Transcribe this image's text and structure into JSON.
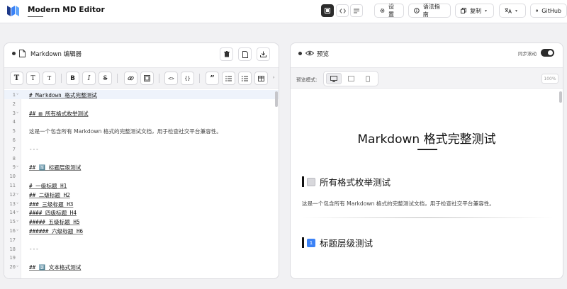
{
  "app": {
    "title": "Modern MD Editor",
    "brand_color": "#3b82f6"
  },
  "toolbar": {
    "view_modes": [
      {
        "name": "edit",
        "icon": "square-icon",
        "active": true
      },
      {
        "name": "split",
        "icon": "code-icon",
        "active": false
      },
      {
        "name": "preview",
        "icon": "lines-icon",
        "active": false
      }
    ],
    "settings_label": "设置",
    "syntax_label": "语法指南",
    "copy_label": "复制",
    "github_label": "GitHub"
  },
  "editor": {
    "title": "Markdown 编辑器",
    "formatting": [
      {
        "name": "heading-size",
        "label": "T"
      },
      {
        "name": "heading-medium",
        "label": "T"
      },
      {
        "name": "heading-small",
        "label": "T"
      },
      {
        "name": "bold",
        "label": "B"
      },
      {
        "name": "italic",
        "label": "I"
      },
      {
        "name": "strike",
        "label": "S"
      },
      {
        "name": "link",
        "label": ""
      },
      {
        "name": "image",
        "label": ""
      },
      {
        "name": "code",
        "label": "<>"
      },
      {
        "name": "code-block",
        "label": "{}"
      },
      {
        "name": "quote",
        "label": "”"
      },
      {
        "name": "bullet-list",
        "label": ""
      },
      {
        "name": "ordered-list",
        "label": ""
      },
      {
        "name": "table",
        "label": ""
      }
    ],
    "lines": [
      {
        "n": "1",
        "text": "# Markdown 格式完整测试",
        "fold": true,
        "kind": "heading",
        "active": true
      },
      {
        "n": "2",
        "text": "",
        "fold": false,
        "kind": "plain"
      },
      {
        "n": "3",
        "text": "## ▥ 所有格式枚举测试",
        "fold": true,
        "kind": "heading"
      },
      {
        "n": "4",
        "text": "",
        "fold": false,
        "kind": "plain"
      },
      {
        "n": "5",
        "text": "这是一个包含所有 Markdown 格式的完整测试文档，用于检查社交平台兼容性。",
        "fold": false,
        "kind": "plain"
      },
      {
        "n": "6",
        "text": "",
        "fold": false,
        "kind": "plain"
      },
      {
        "n": "7",
        "text": "---",
        "fold": false,
        "kind": "hr"
      },
      {
        "n": "8",
        "text": "",
        "fold": false,
        "kind": "plain"
      },
      {
        "n": "9",
        "text": "## 1️⃣ 标题层级测试",
        "fold": true,
        "kind": "heading"
      },
      {
        "n": "10",
        "text": "",
        "fold": false,
        "kind": "plain"
      },
      {
        "n": "11",
        "text": "# 一级标题 H1",
        "fold": false,
        "kind": "heading"
      },
      {
        "n": "12",
        "text": "## 二级标题 H2",
        "fold": true,
        "kind": "heading"
      },
      {
        "n": "13",
        "text": "### 三级标题 H3",
        "fold": true,
        "kind": "heading"
      },
      {
        "n": "14",
        "text": "#### 四级标题 H4",
        "fold": true,
        "kind": "heading"
      },
      {
        "n": "15",
        "text": "##### 五级标题 H5",
        "fold": true,
        "kind": "heading"
      },
      {
        "n": "16",
        "text": "###### 六级标题 H6",
        "fold": true,
        "kind": "heading"
      },
      {
        "n": "17",
        "text": "",
        "fold": false,
        "kind": "plain"
      },
      {
        "n": "18",
        "text": "---",
        "fold": false,
        "kind": "hr"
      },
      {
        "n": "19",
        "text": "",
        "fold": false,
        "kind": "plain"
      },
      {
        "n": "20",
        "text": "## 2️⃣ 文本格式测试",
        "fold": true,
        "kind": "heading"
      }
    ]
  },
  "preview": {
    "title": "预览",
    "sync_label": "同步滚动",
    "sync_on": true,
    "mode_label": "预览模式:",
    "zoom": "100%",
    "doc_title": "Markdown 格式完整测试",
    "sections": [
      {
        "emoji": "▥",
        "emoji_style": "gray",
        "heading": "所有格式枚举测试"
      },
      {
        "emoji": "1",
        "emoji_style": "blue",
        "heading": "标题层级测试"
      }
    ],
    "paragraph": "这是一个包含所有 Markdown 格式的完整测试文档，用于检查社交平台兼容性。"
  }
}
